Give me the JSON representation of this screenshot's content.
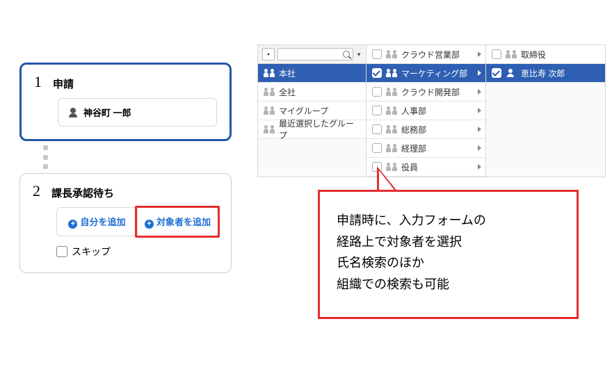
{
  "steps": {
    "s1": {
      "num": "1",
      "title": "申請",
      "person": "神谷町 一郎"
    },
    "s2": {
      "num": "2",
      "title": "課長承認待ち",
      "add_self": "自分を追加",
      "add_target": "対象者を追加",
      "skip": "スキップ"
    }
  },
  "picker": {
    "col0": {
      "items": [
        "本社",
        "全社",
        "マイグループ",
        "最近選択したグループ"
      ],
      "selected_index": 0
    },
    "col1": {
      "items": [
        "クラウド営業部",
        "マーケティング部",
        "クラウド開発部",
        "人事部",
        "総務部",
        "経理部",
        "役員"
      ],
      "selected_index": 1
    },
    "col2": {
      "items": [
        "取締役",
        "恵比寿 次郎"
      ],
      "selected_index": 1
    }
  },
  "speech": {
    "l1": "申請時に、入力フォームの",
    "l2": "経路上で対象者を選択",
    "l3": "氏名検索のほか",
    "l4": "組織での検索も可能"
  }
}
